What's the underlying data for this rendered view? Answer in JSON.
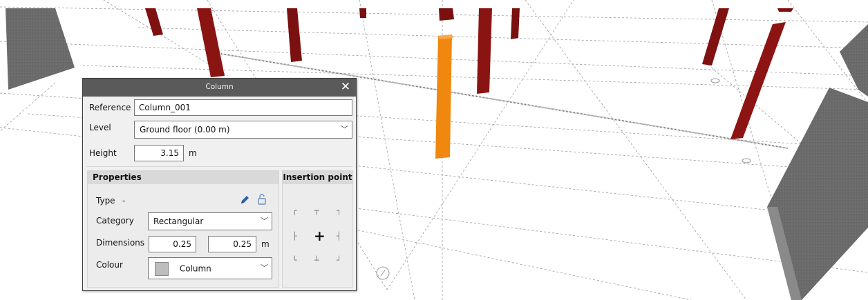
{
  "dialog": {
    "title": "Column",
    "close_glyph": "✕",
    "reference_label": "Reference",
    "reference_value": "Column_001",
    "level_label": "Level",
    "level_value": "Ground floor (0.00 m)",
    "height_label": "Height",
    "height_value": "3.15",
    "height_unit": "m"
  },
  "properties": {
    "header": "Properties",
    "type_label": "Type",
    "type_value": "-",
    "category_label": "Category",
    "category_value": "Rectangular",
    "dimensions_label": "Dimensions",
    "dim_x": "0.25",
    "dim_y": "0.25",
    "dim_unit": "m",
    "colour_label": "Colour",
    "colour_value": "Column",
    "colour_swatch": "#bdbdbd"
  },
  "insertion_point": {
    "header": "Insertion point",
    "center_glyph": "+"
  },
  "icons": {
    "edit": "pencil-icon",
    "lock": "unlock-icon",
    "dropdown": "chevron-down-icon"
  },
  "colors": {
    "titlebar": "#5a5a5a",
    "selected_column": "#f0870f",
    "column": "#8b1412",
    "wall": "#6e6e6e"
  }
}
